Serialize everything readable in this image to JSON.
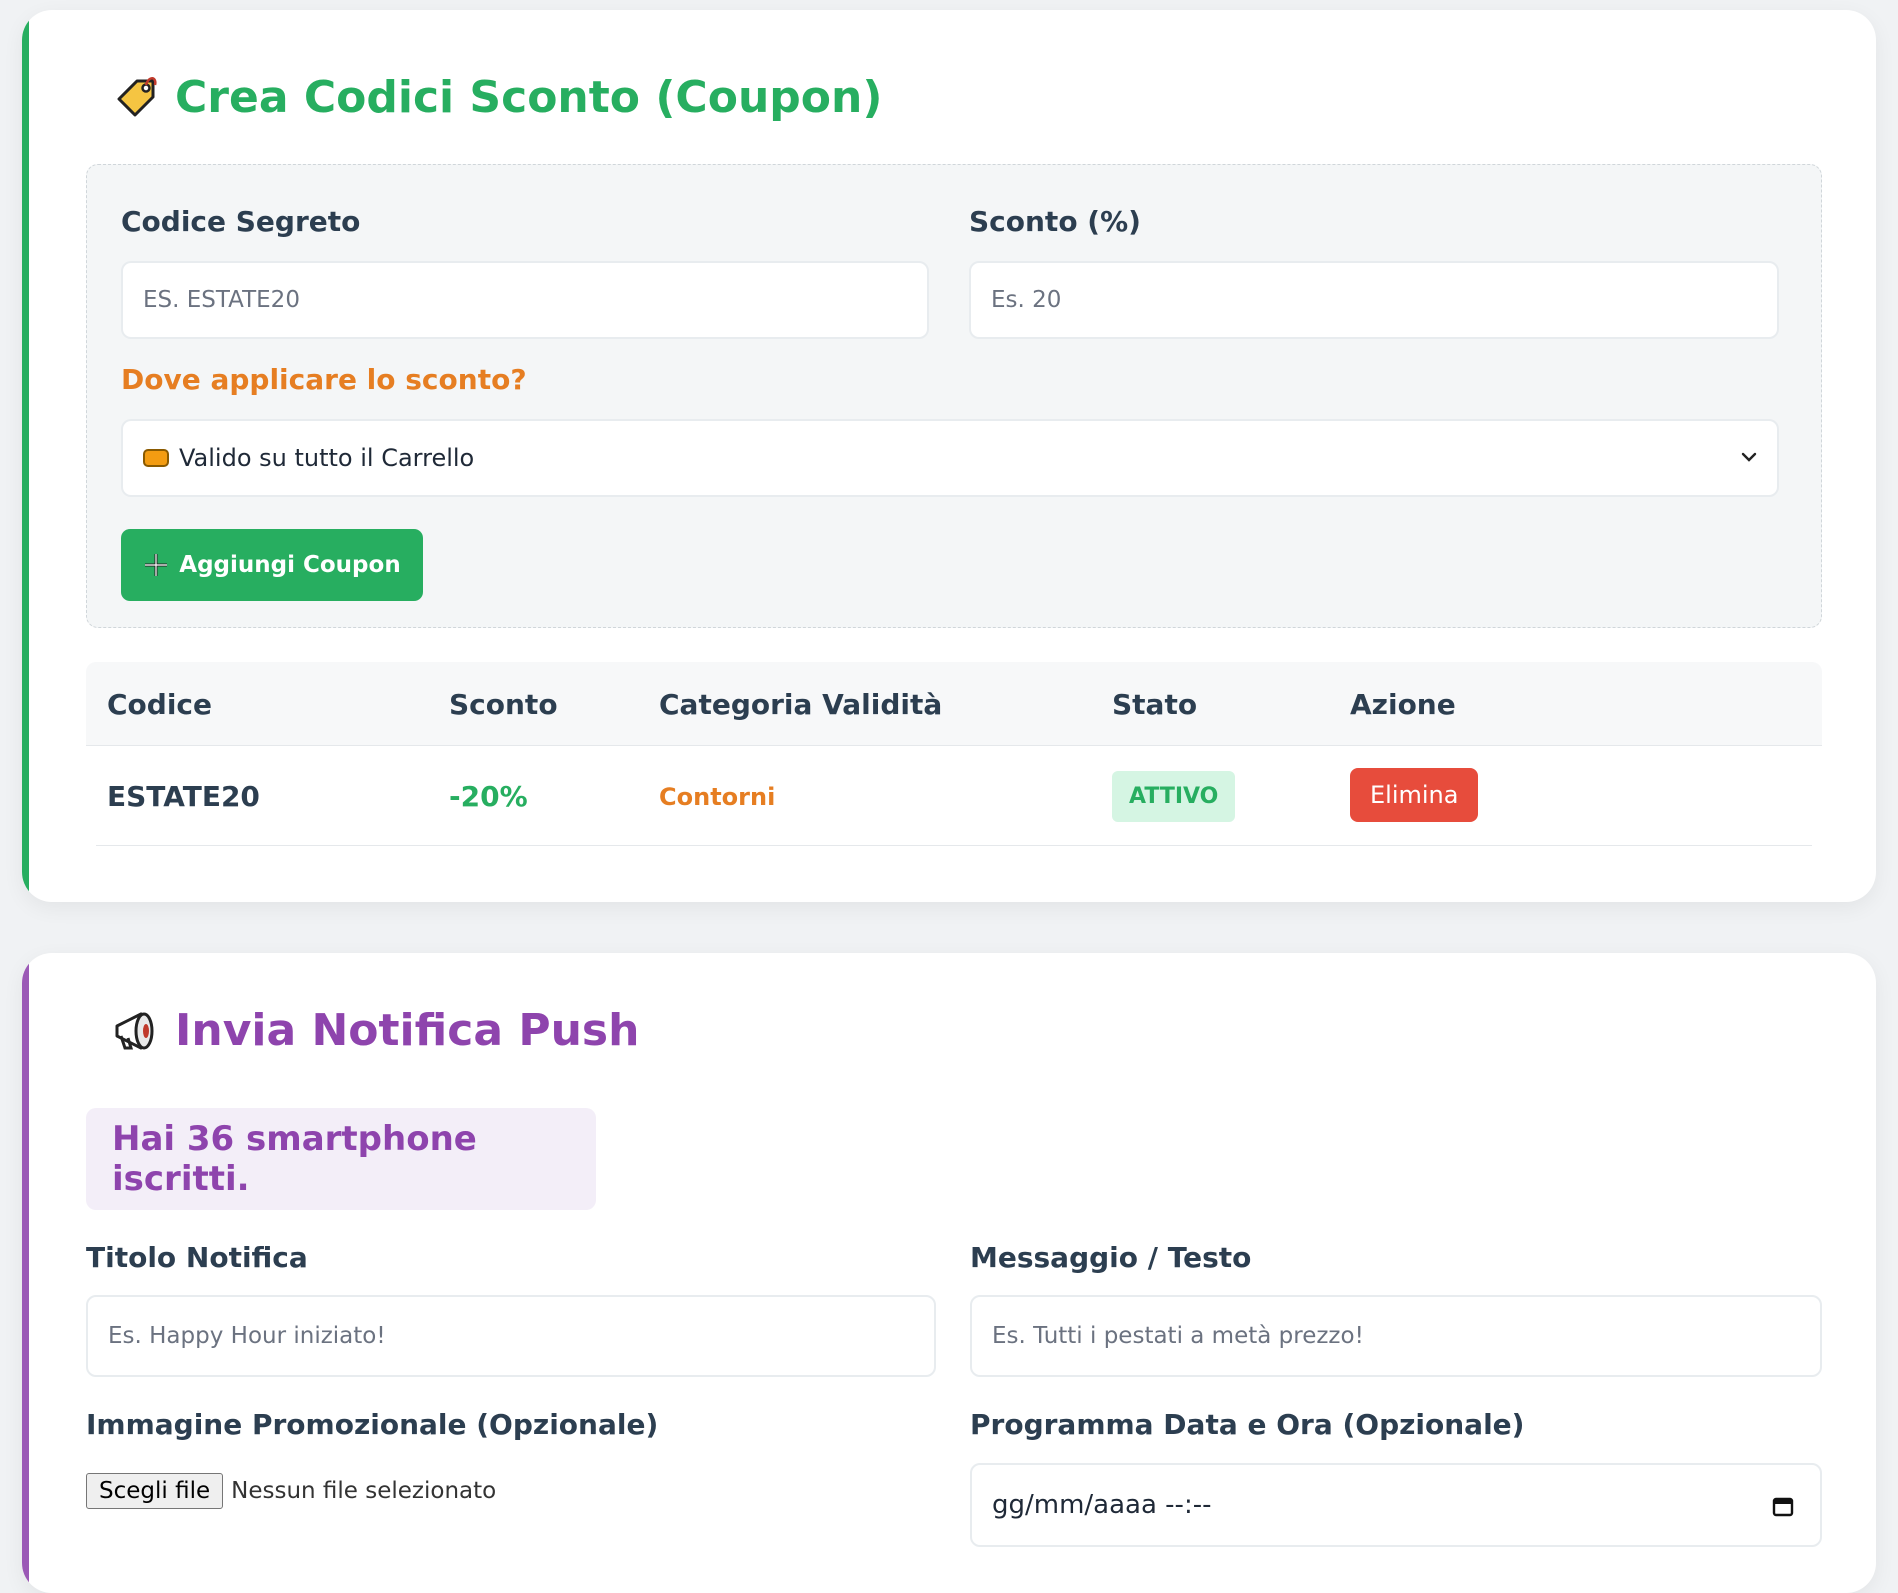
{
  "coupon": {
    "title": "Crea Codici Sconto (Coupon)",
    "title_icon": "tag-icon",
    "accent": "#27ae60",
    "code_label": "Codice Segreto",
    "code_placeholder": "ES. ESTATE20",
    "discount_label": "Sconto (%)",
    "discount_placeholder": "Es. 20",
    "apply_label": "Dove applicare lo sconto?",
    "apply_selected": "Valido su tutto il Carrello",
    "add_button": "Aggiungi Coupon",
    "table": {
      "headers": [
        "Codice",
        "Sconto",
        "Categoria Validità",
        "Stato",
        "Azione"
      ],
      "rows": [
        {
          "code": "ESTATE20",
          "discount": "-20%",
          "category": "Contorni",
          "status": "ATTIVO",
          "action": "Elimina"
        }
      ]
    }
  },
  "push": {
    "title": "Invia Notifica Push",
    "title_icon": "megaphone-icon",
    "accent": "#8e44ad",
    "subscribers": "Hai 36 smartphone iscritti.",
    "title_label": "Titolo Notifica",
    "title_placeholder": "Es. Happy Hour iniziato!",
    "message_label": "Messaggio / Testo",
    "message_placeholder": "Es. Tutti i pestati a metà prezzo!",
    "image_label": "Immagine Promozionale (Opzionale)",
    "file_button": "Scegli file",
    "file_status": "Nessun file selezionato",
    "schedule_label": "Programma Data e Ora (Opzionale)",
    "schedule_placeholder": "gg/mm/aaaa --:--"
  }
}
